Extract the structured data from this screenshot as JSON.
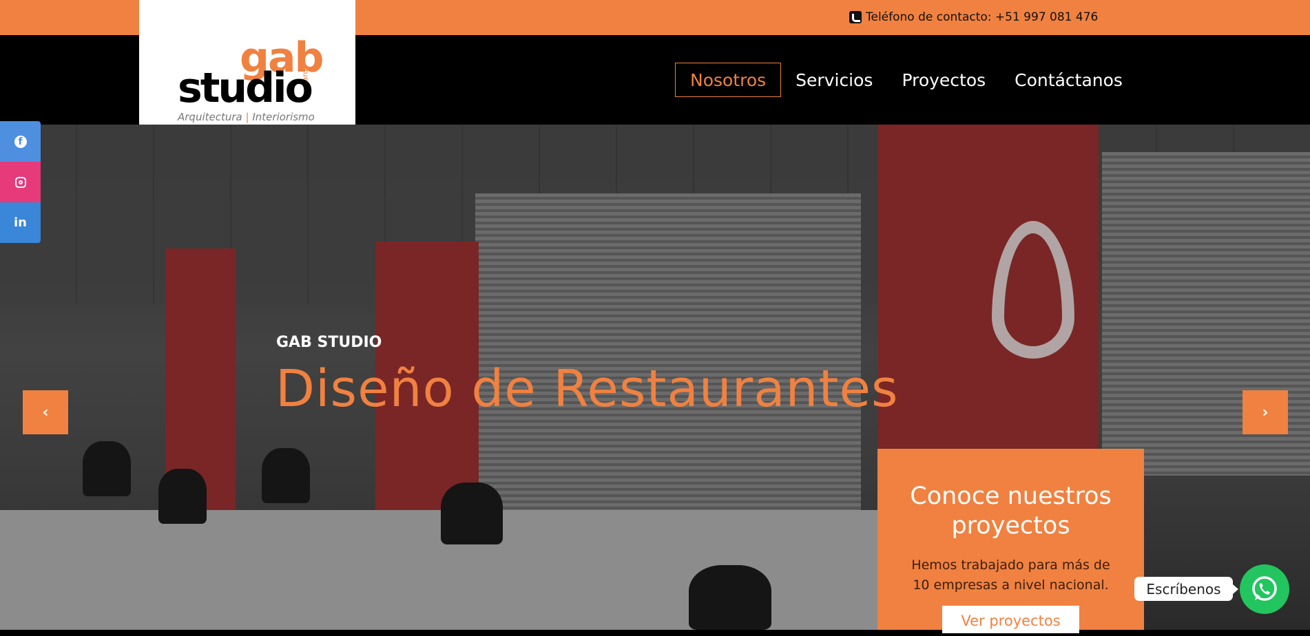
{
  "topbar": {
    "phone_label": "Teléfono de contacto: +51 997 081 476"
  },
  "logo": {
    "word_top": "gab",
    "word_main": "studio",
    "suffix": "arq",
    "tagline_left": "Arquitectura",
    "tagline_sep": "|",
    "tagline_right": "Interiorismo"
  },
  "nav": {
    "items": [
      {
        "label": "Nosotros",
        "active": true
      },
      {
        "label": "Servicios",
        "active": false
      },
      {
        "label": "Proyectos",
        "active": false
      },
      {
        "label": "Contáctanos",
        "active": false
      }
    ]
  },
  "social": {
    "facebook_icon": "f",
    "linkedin_icon": "in"
  },
  "hero": {
    "eyebrow": "GAB STUDIO",
    "headline": "Diseño de Restaurantes",
    "prev_icon": "‹",
    "next_icon": "›"
  },
  "card": {
    "title": "Conoce nuestros proyectos",
    "text": "Hemos trabajado para más de 10 empresas a nivel nacional.",
    "button": "Ver proyectos"
  },
  "chat": {
    "label": "Escríbenos"
  },
  "colors": {
    "accent": "#f08140",
    "facebook": "#4e8fe0",
    "instagram": "#e63a7b",
    "linkedin": "#3a86d8",
    "whatsapp": "#22c55e"
  }
}
